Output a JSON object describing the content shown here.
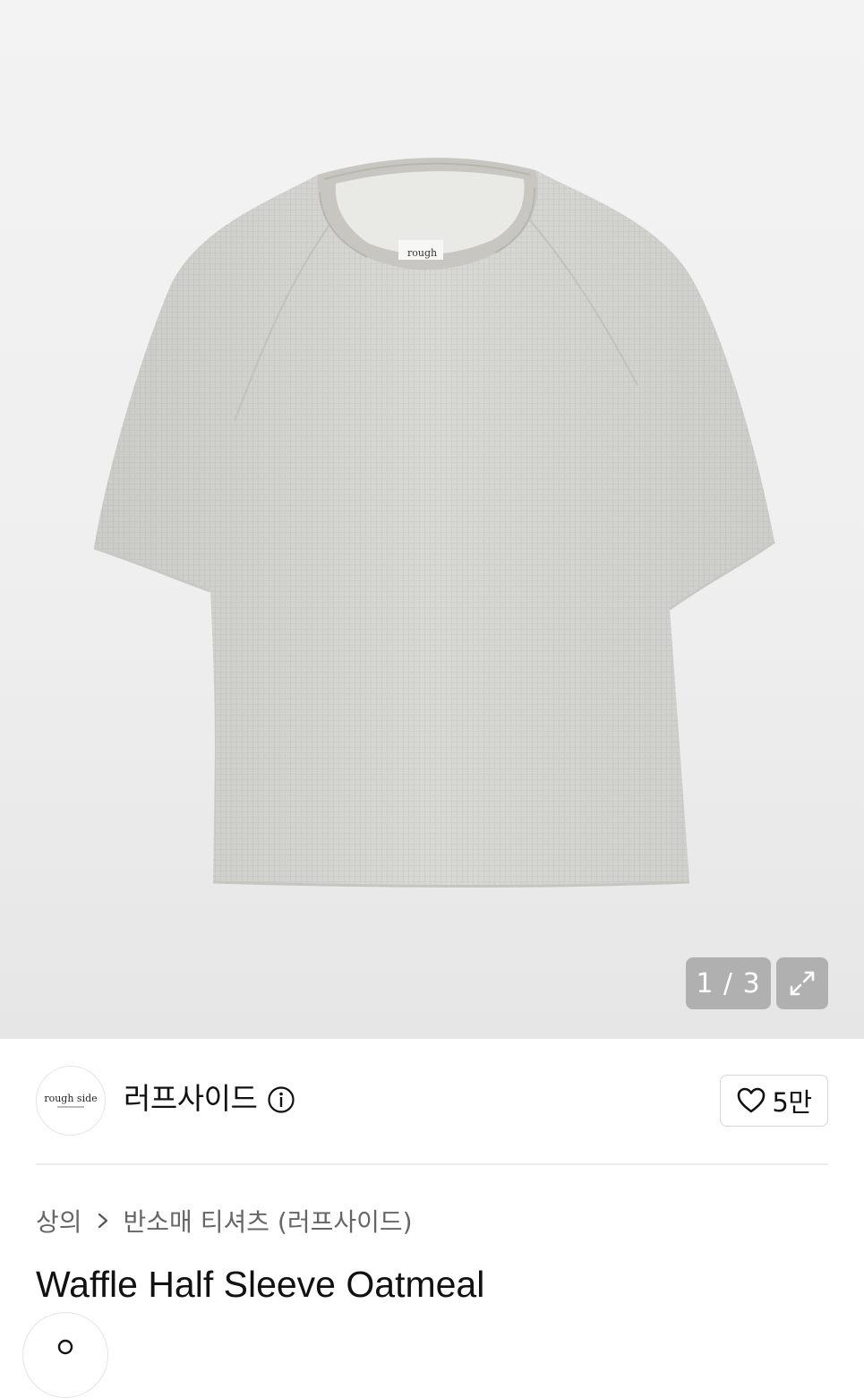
{
  "gallery": {
    "current": 1,
    "total": 3,
    "pager_text": "1 / 3",
    "tag_label": "rough"
  },
  "brand": {
    "logo_text": "rough side",
    "name": "러프사이드",
    "like_count": "5만"
  },
  "breadcrumb": {
    "items": [
      "상의",
      "반소매 티셔츠 (러프사이드)"
    ]
  },
  "product": {
    "title": "Waffle Half Sleeve Oatmeal"
  },
  "colors": {
    "shirt": "#d9d9d5",
    "background": "#f0f0f0",
    "badge_bg": "#a0a0a0"
  }
}
